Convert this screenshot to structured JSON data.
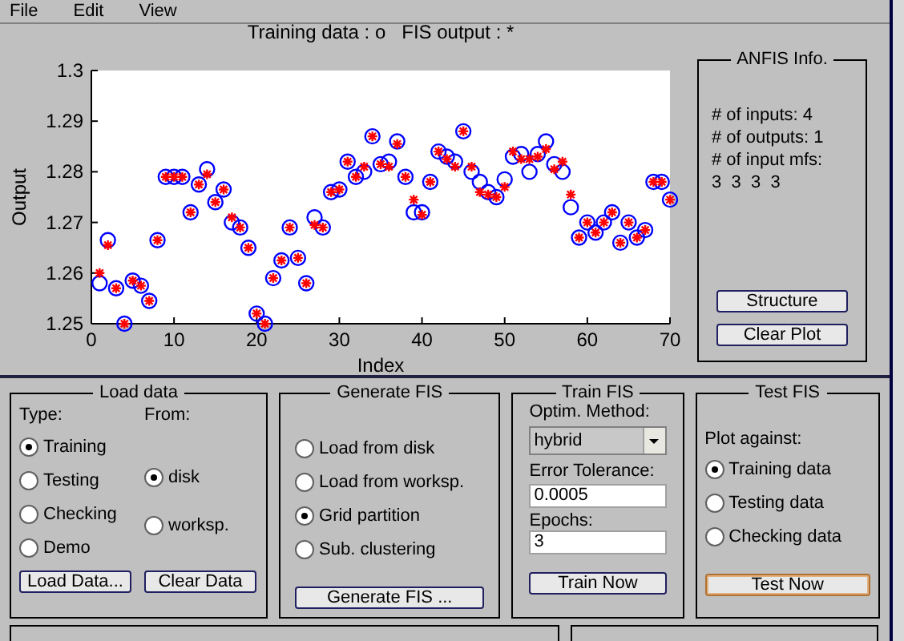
{
  "menu": [
    {
      "label": "File"
    },
    {
      "label": "Edit"
    },
    {
      "label": "View"
    }
  ],
  "plot": {
    "chart_data": {
      "type": "scatter",
      "title": "Training data : o   FIS output : *",
      "xlabel": "Index",
      "ylabel": "Output",
      "xlim": [
        0,
        70
      ],
      "ylim": [
        1.25,
        1.3
      ],
      "xticks": [
        0,
        10,
        20,
        30,
        40,
        50,
        60,
        70
      ],
      "yticks": [
        {
          "value": 1.25,
          "label": "1.25"
        },
        {
          "value": 1.26,
          "label": "1.26"
        },
        {
          "value": 1.27,
          "label": "1.27"
        },
        {
          "value": 1.28,
          "label": "1.28"
        },
        {
          "value": 1.29,
          "label": "1.29"
        },
        {
          "value": 1.3,
          "label": "1.3"
        }
      ],
      "x": [
        1,
        2,
        3,
        4,
        5,
        6,
        7,
        8,
        9,
        10,
        11,
        12,
        13,
        14,
        15,
        16,
        17,
        18,
        19,
        20,
        21,
        22,
        23,
        24,
        25,
        26,
        27,
        28,
        29,
        30,
        31,
        32,
        33,
        34,
        35,
        36,
        37,
        38,
        39,
        40,
        41,
        42,
        43,
        44,
        45,
        46,
        47,
        48,
        49,
        50,
        51,
        52,
        53,
        54,
        55,
        56,
        57,
        58,
        59,
        60,
        61,
        62,
        63,
        64,
        65,
        66,
        67,
        68,
        69,
        70
      ],
      "series": [
        {
          "marker": "circle",
          "color": "#0000ff",
          "values": [
            1.258,
            1.2665,
            1.257,
            1.25,
            1.2585,
            1.2575,
            1.2545,
            1.2665,
            1.279,
            1.279,
            1.279,
            1.272,
            1.2775,
            1.2805,
            1.274,
            1.2765,
            1.27,
            1.269,
            1.265,
            1.252,
            1.25,
            1.259,
            1.2625,
            1.269,
            1.263,
            1.258,
            1.271,
            1.269,
            1.276,
            1.2765,
            1.282,
            1.279,
            1.28,
            1.287,
            1.2815,
            1.282,
            1.286,
            1.279,
            1.272,
            1.272,
            1.278,
            1.284,
            1.283,
            1.282,
            1.288,
            1.28,
            1.278,
            1.276,
            1.275,
            1.2785,
            1.283,
            1.2835,
            1.28,
            1.2835,
            1.286,
            1.2815,
            1.28,
            1.273,
            1.267,
            1.27,
            1.268,
            1.27,
            1.272,
            1.266,
            1.27,
            1.267,
            1.2685,
            1.278,
            1.278,
            1.2745
          ]
        },
        {
          "marker": "cross",
          "color": "#ff0000",
          "values": [
            1.26,
            1.2655,
            1.257,
            1.25,
            1.2585,
            1.2575,
            1.2545,
            1.2665,
            1.279,
            1.279,
            1.279,
            1.272,
            1.2775,
            1.2795,
            1.274,
            1.2765,
            1.271,
            1.269,
            1.265,
            1.252,
            1.25,
            1.259,
            1.2625,
            1.269,
            1.263,
            1.258,
            1.2695,
            1.269,
            1.276,
            1.2765,
            1.282,
            1.279,
            1.281,
            1.287,
            1.2815,
            1.281,
            1.2855,
            1.279,
            1.2745,
            1.2715,
            1.278,
            1.284,
            1.2825,
            1.281,
            1.288,
            1.281,
            1.276,
            1.2755,
            1.275,
            1.277,
            1.284,
            1.2825,
            1.2825,
            1.283,
            1.2845,
            1.2805,
            1.282,
            1.2755,
            1.267,
            1.27,
            1.268,
            1.27,
            1.272,
            1.266,
            1.27,
            1.267,
            1.2685,
            1.278,
            1.278,
            1.2745
          ]
        }
      ]
    }
  },
  "anfis_info": {
    "title": "ANFIS Info.",
    "lines": [
      "# of inputs: 4",
      "# of outputs: 1",
      "# of input mfs:",
      "3  3  3  3"
    ],
    "buttons": [
      {
        "label": "Structure"
      },
      {
        "label": "Clear Plot"
      }
    ]
  },
  "load_data": {
    "title": "Load data",
    "type_label": "Type:",
    "from_label": "From:",
    "types": [
      {
        "label": "Training",
        "selected": true
      },
      {
        "label": "Testing",
        "selected": false
      },
      {
        "label": "Checking",
        "selected": false
      },
      {
        "label": "Demo",
        "selected": false
      }
    ],
    "sources": [
      {
        "label": "disk",
        "selected": true
      },
      {
        "label": "worksp.",
        "selected": false
      }
    ],
    "buttons": [
      {
        "label": "Load Data..."
      },
      {
        "label": "Clear Data"
      }
    ]
  },
  "generate_fis": {
    "title": "Generate FIS",
    "options": [
      {
        "label": "Load from disk",
        "selected": false
      },
      {
        "label": "Load from worksp.",
        "selected": false
      },
      {
        "label": "Grid partition",
        "selected": true
      },
      {
        "label": "Sub. clustering",
        "selected": false
      }
    ],
    "button": {
      "label": "Generate FIS ..."
    }
  },
  "train_fis": {
    "title": "Train FIS",
    "method_label": "Optim. Method:",
    "method": "hybrid",
    "tolerance_label": "Error Tolerance:",
    "tolerance": "0.0005",
    "epochs_label": "Epochs:",
    "epochs": "3",
    "button": {
      "label": "Train Now"
    }
  },
  "test_fis": {
    "title": "Test FIS",
    "plot_label": "Plot against:",
    "options": [
      {
        "label": "Training data",
        "selected": true
      },
      {
        "label": "Testing data",
        "selected": false
      },
      {
        "label": "Checking data",
        "selected": false
      }
    ],
    "button": {
      "label": "Test Now",
      "focused": true
    }
  }
}
